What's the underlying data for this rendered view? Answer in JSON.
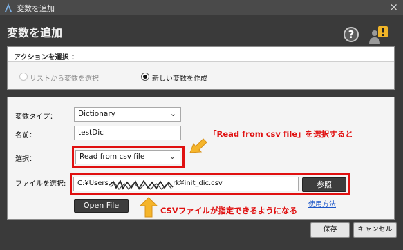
{
  "window": {
    "title": "変数を追加",
    "close": "×"
  },
  "header": {
    "title": "変数を追加",
    "help": "?"
  },
  "action": {
    "heading": "アクションを選択 ：",
    "options": [
      "リストから変数を選択",
      "新しい変数を作成"
    ],
    "selected": 1
  },
  "form": {
    "type_label": "変数タイプ：",
    "type_value": "Dictionary",
    "name_label": "名前：",
    "name_value": "testDic",
    "select_label": "選択：",
    "select_value": "Read from csv file",
    "file_label": "ファイルを選択:",
    "file_path": "C:¥Users¥                     ¥Documents¥work¥init_dic.csv",
    "browse_label": "参照",
    "open_file_label": "Open File",
    "usage_link": "使用方法"
  },
  "annotations": {
    "select_note": "「Read from csv file」を選択すると",
    "file_note": "CSVファイルが指定できるようになる"
  },
  "footer": {
    "save_label": "保存",
    "cancel_label": "キャンセル"
  },
  "colors": {
    "annotation_red": "#e01010",
    "arrow_yellow": "#f5b52b",
    "link_blue": "#1a55c8"
  }
}
